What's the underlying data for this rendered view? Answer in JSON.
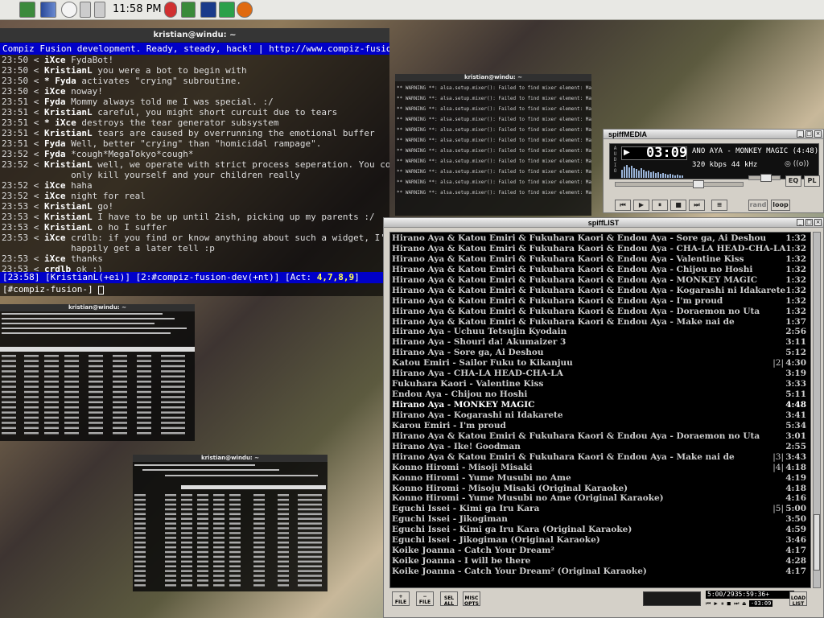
{
  "panel": {
    "clock": "11:58 PM"
  },
  "irc": {
    "title": "kristian@windu: ~",
    "topic": "Compiz Fusion development. Ready, steady, hack! | http://www.compiz-fusion.org/",
    "lines": [
      {
        "time": "23:50",
        "nick": "iXce",
        "text": "FydaBot!"
      },
      {
        "time": "23:50",
        "nick": "KristianL",
        "text": "you were a bot to begin with"
      },
      {
        "time": "23:50",
        "nick": "* Fyda",
        "text": "activates \"crying\" subroutine."
      },
      {
        "time": "23:50",
        "nick": "iXce",
        "text": "noway!"
      },
      {
        "time": "23:51",
        "nick": "Fyda",
        "text": "Mommy always told me I was special. :/"
      },
      {
        "time": "23:51",
        "nick": "KristianL",
        "text": "careful, you might short curcuit due to tears"
      },
      {
        "time": "23:51",
        "nick": "* iXce",
        "text": "destroys the tear generator subsystem"
      },
      {
        "time": "23:51",
        "nick": "KristianL",
        "text": "tears are caused by overrunning the emotional buffer"
      },
      {
        "time": "23:51",
        "nick": "Fyda",
        "text": "Well, better \"crying\" than \"homicidal rampage\"."
      },
      {
        "time": "23:52",
        "nick": "Fyda",
        "text": "*cough*MegaTokyo*cough*"
      },
      {
        "time": "23:52",
        "nick": "KristianL",
        "text": "well, we operate with strict process seperation. You could"
      },
      {
        "time": "",
        "nick": "",
        "text": "only kill yourself and your children really"
      },
      {
        "time": "23:52",
        "nick": "iXce",
        "text": "haha"
      },
      {
        "time": "23:52",
        "nick": "iXce",
        "text": "night for real"
      },
      {
        "time": "23:53",
        "nick": "KristianL",
        "text": "go!"
      },
      {
        "time": "23:53",
        "nick": "KristianL",
        "text": "I have to be up until 2ish, picking up my parents :/"
      },
      {
        "time": "23:53",
        "nick": "KristianL",
        "text": "o ho I suffer"
      },
      {
        "time": "23:53",
        "nick": "iXce",
        "text": "crdlb: if you find or know anything about such a widget, I'd"
      },
      {
        "time": "",
        "nick": "",
        "text": "happily get a later tell :p"
      },
      {
        "time": "23:53",
        "nick": "iXce",
        "text": "thanks"
      },
      {
        "time": "23:53",
        "nick": "crdlb",
        "text": "ok :)"
      }
    ],
    "status_pre": "[23:58] [KristianL(+ei)] [2:#compiz-fusion-dev(+nt)] [Act: ",
    "status_act": "4,7,8,9",
    "status_post": "]",
    "prompt": "[#compiz-fusion-] "
  },
  "warnings": {
    "title": "kristian@windu: ~",
    "line": "** WARNING **: alsa.setup.mixer(): Failed to find mixer element: Master"
  },
  "top": {
    "title": "kristian@windu: ~"
  },
  "xrestop": {
    "title": "kristian@windu: ~"
  },
  "media": {
    "title": "spiffMEDIA",
    "time": "03:09",
    "song": "ANO AYA - MONKEY MAGIC (4:48)",
    "bitrate": "320 kbps  44 kHz",
    "mode": "stereo",
    "vlabel": "A U D I O",
    "eq": "EQ",
    "pl": "PL",
    "rand": "rand",
    "loop": "loop",
    "progress": 0.66
  },
  "list": {
    "title": "spiffLIST",
    "tracks": [
      {
        "t": "Hirano Aya & Katou Emiri & Fukuhara Kaori & Endou Aya - Sore ga, Ai Deshou",
        "d": "1:32"
      },
      {
        "t": "Hirano Aya & Katou Emiri & Fukuhara Kaori & Endou Aya - CHA-LA HEAD-CHA-LA",
        "d": "1:32"
      },
      {
        "t": "Hirano Aya & Katou Emiri & Fukuhara Kaori & Endou Aya - Valentine Kiss",
        "d": "1:32"
      },
      {
        "t": "Hirano Aya & Katou Emiri & Fukuhara Kaori & Endou Aya - Chijou no Hoshi",
        "d": "1:32"
      },
      {
        "t": "Hirano Aya & Katou Emiri & Fukuhara Kaori & Endou Aya - MONKEY MAGIC",
        "d": "1:32"
      },
      {
        "t": "Hirano Aya & Katou Emiri & Fukuhara Kaori & Endou Aya - Kogarashi ni Idakarete",
        "d": "1:32"
      },
      {
        "t": "Hirano Aya & Katou Emiri & Fukuhara Kaori & Endou Aya - I'm proud",
        "d": "1:32"
      },
      {
        "t": "Hirano Aya & Katou Emiri & Fukuhara Kaori & Endou Aya - Doraemon no Uta",
        "d": "1:32"
      },
      {
        "t": "Hirano Aya & Katou Emiri & Fukuhara Kaori & Endou Aya - Make nai de",
        "d": "1:37"
      },
      {
        "t": "Hirano Aya - Uchuu Tetsujin Kyodain",
        "d": "2:56"
      },
      {
        "t": "Hirano Aya - Shouri da! Akumaizer 3",
        "d": "3:11"
      },
      {
        "t": "Hirano Aya - Sore ga, Ai Deshou",
        "d": "5:12"
      },
      {
        "t": "Katou Emiri - Sailor Fuku to Kikanjuu",
        "d": "4:30",
        "q": "|2|"
      },
      {
        "t": "Hirano Aya - CHA-LA HEAD-CHA-LA",
        "d": "3:19"
      },
      {
        "t": "Fukuhara Kaori - Valentine Kiss",
        "d": "3:33"
      },
      {
        "t": "Endou Aya - Chijou no Hoshi",
        "d": "5:11"
      },
      {
        "t": "Hirano Aya - MONKEY MAGIC",
        "d": "4:48",
        "cur": true
      },
      {
        "t": "Hirano Aya - Kogarashi ni Idakarete",
        "d": "3:41"
      },
      {
        "t": "Karou Emiri - I'm proud",
        "d": "5:34"
      },
      {
        "t": "Hirano Aya & Katou Emiri & Fukuhara Kaori & Endou Aya - Doraemon no Uta",
        "d": "3:01"
      },
      {
        "t": "Hirano Aya - Ike! Goodman",
        "d": "2:55"
      },
      {
        "t": "Hirano Aya & Katou Emiri & Fukuhara Kaori & Endou Aya - Make nai de",
        "d": "3:43",
        "q": "|3|"
      },
      {
        "t": "Konno Hiromi - Misoji Misaki",
        "d": "4:18",
        "q": "|4|"
      },
      {
        "t": "Konno Hiromi - Yume Musubi no Ame",
        "d": "4:19"
      },
      {
        "t": "Konno Hiromi - Misoju Misaki (Original Karaoke)",
        "d": "4:18"
      },
      {
        "t": "Konno Hiromi - Yume Musubi no Ame (Original Karaoke)",
        "d": "4:16"
      },
      {
        "t": "Eguchi Issei - Kimi ga Iru Kara",
        "d": "5:00",
        "q": "|5|"
      },
      {
        "t": "Eguchi Issei - Jikogiman",
        "d": "3:50"
      },
      {
        "t": "Eguchi Issei - Kimi ga Iru Kara (Original Karaoke)",
        "d": "4:59"
      },
      {
        "t": "Eguchi Issei - Jikogiman (Original Karaoke)",
        "d": "3:46"
      },
      {
        "t": "Koike Joanna - Catch Your Dream²",
        "d": "4:17"
      },
      {
        "t": "Koike Joanna - I will be there",
        "d": "4:28"
      },
      {
        "t": "Koike Joanna - Catch Your Dream² (Original Karaoke)",
        "d": "4:17"
      }
    ],
    "buttons": [
      "FILE",
      "FILE",
      "SEL ALL",
      "MISC OPTS"
    ],
    "load": "LOAD LIST",
    "total": "5:00/2935:59:36+",
    "remaining": "-03:09"
  }
}
